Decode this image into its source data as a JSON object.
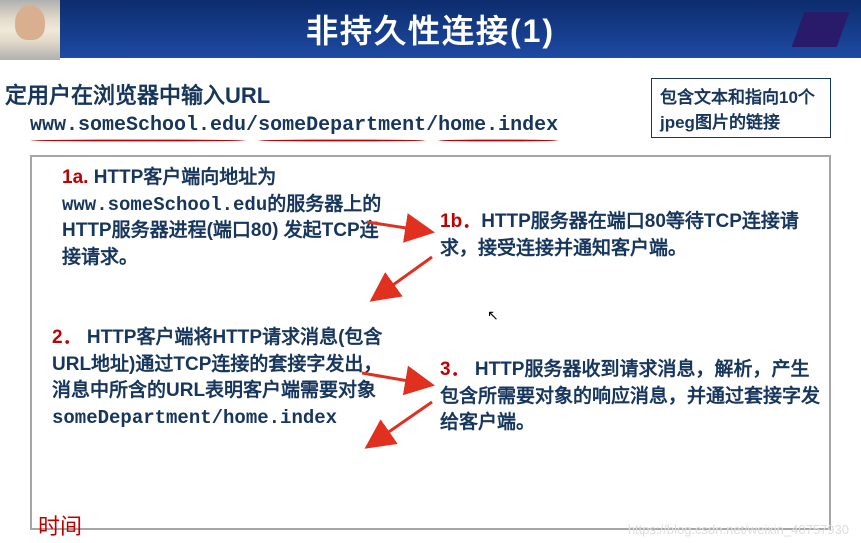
{
  "title": "非持久性连接(1)",
  "intro": "定用户在浏览器中输入URL",
  "url_seg1": "www.someSchool.edu",
  "url_seg2": "someDepartment",
  "url_seg3": "home.index",
  "sep": "/",
  "infobox": "包含文本和指向10个jpeg图片的链接",
  "steps": {
    "s1a": {
      "num": "1a.",
      "text": "HTTP客户端向地址为",
      "host": "www.someSchool.edu",
      "tail": "的服务器上的HTTP服务器进程(端口80) 发起TCP连接请求。"
    },
    "s1b": {
      "num": "1b．",
      "text": "HTTP服务器在端口80等待TCP连接请求，接受连接并通知客户端。"
    },
    "s2": {
      "num": "2．",
      "text": "HTTP客户端将HTTP请求消息(包含URL地址)通过TCP连接的套接字发出，消息中所含的URL表明客户端需要对象",
      "obj": "someDepartment/home.index"
    },
    "s3": {
      "num": "3．",
      "text": "HTTP服务器收到请求消息，解析，产生包含所需要对象的响应消息，并通过套接字发给客户端。"
    }
  },
  "time_label": "时间",
  "watermark": "https://blog.csdn.net/weixin_40757930"
}
